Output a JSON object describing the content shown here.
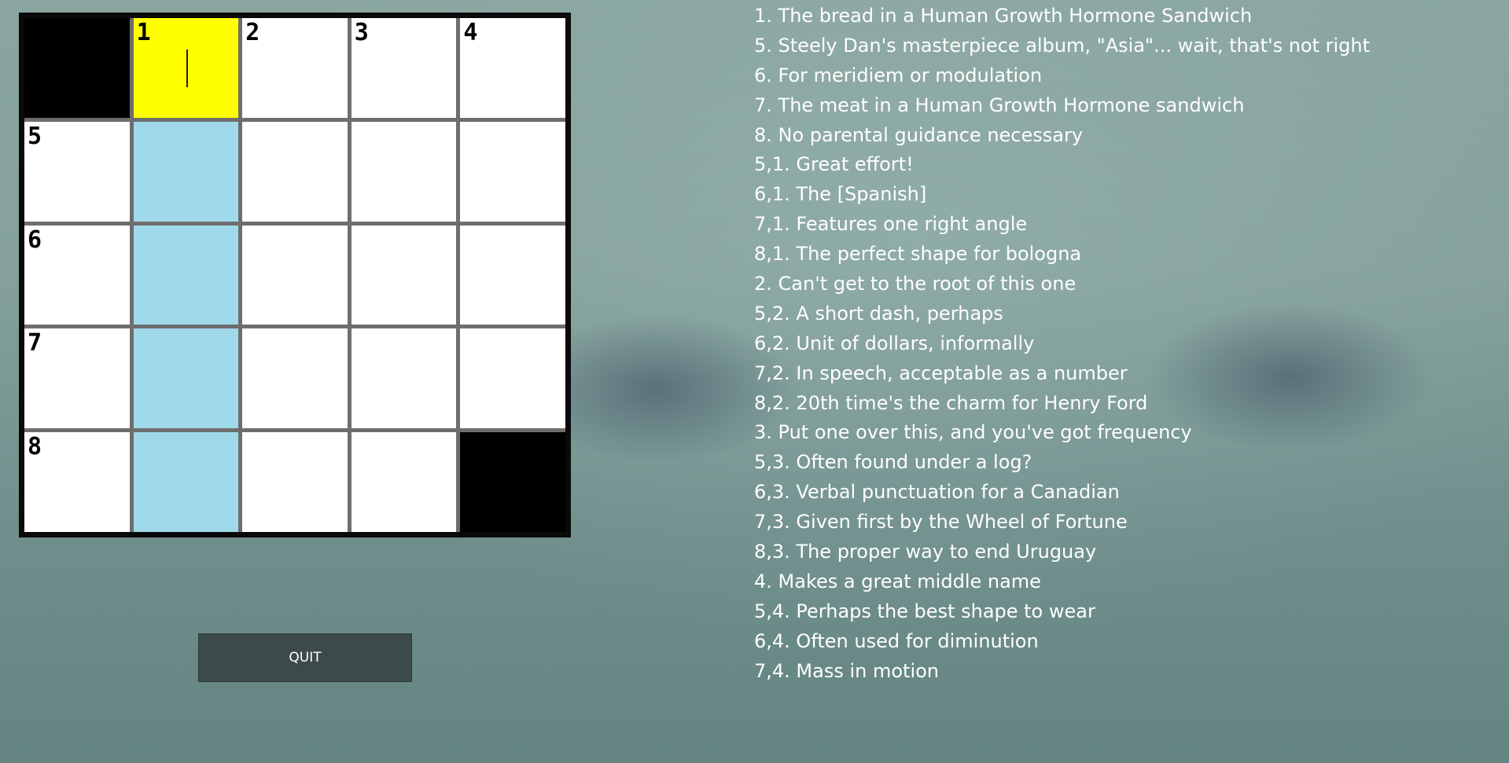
{
  "grid": {
    "rows": [
      [
        {
          "type": "block",
          "number": ""
        },
        {
          "type": "active",
          "number": "1"
        },
        {
          "type": "open",
          "number": "2"
        },
        {
          "type": "open",
          "number": "3"
        },
        {
          "type": "open",
          "number": "4"
        }
      ],
      [
        {
          "type": "open",
          "number": "5"
        },
        {
          "type": "highlight",
          "number": ""
        },
        {
          "type": "open",
          "number": ""
        },
        {
          "type": "open",
          "number": ""
        },
        {
          "type": "open",
          "number": ""
        }
      ],
      [
        {
          "type": "open",
          "number": "6"
        },
        {
          "type": "highlight",
          "number": ""
        },
        {
          "type": "open",
          "number": ""
        },
        {
          "type": "open",
          "number": ""
        },
        {
          "type": "open",
          "number": ""
        }
      ],
      [
        {
          "type": "open",
          "number": "7"
        },
        {
          "type": "highlight",
          "number": ""
        },
        {
          "type": "open",
          "number": ""
        },
        {
          "type": "open",
          "number": ""
        },
        {
          "type": "open",
          "number": ""
        }
      ],
      [
        {
          "type": "open",
          "number": "8"
        },
        {
          "type": "highlight",
          "number": ""
        },
        {
          "type": "open",
          "number": ""
        },
        {
          "type": "open",
          "number": ""
        },
        {
          "type": "block",
          "number": ""
        }
      ]
    ],
    "colors": {
      "active": "#ffff00",
      "highlight": "#9fd9ea",
      "block": "#000000",
      "open": "#ffffff"
    }
  },
  "quit_label": "QUIT",
  "clues": [
    "1. The bread in a Human Growth Hormone Sandwich",
    "5. Steely Dan's masterpiece album, \"Asia\"... wait, that's not right",
    "6. For meridiem or modulation",
    "7. The meat in a Human Growth Hormone sandwich",
    "8. No parental guidance necessary",
    "5,1. Great effort!",
    "6,1. The [Spanish]",
    "7,1. Features one right angle",
    "8,1. The perfect shape for bologna",
    "2. Can't get to the root of this one",
    "5,2. A short dash, perhaps",
    "6,2. Unit of dollars, informally",
    "7,2. In speech, acceptable as a number",
    "8,2. 20th time's the charm for Henry Ford",
    "3. Put one over this, and you've got frequency",
    "5,3. Often found under a log?",
    "6,3. Verbal punctuation for a Canadian",
    "7,3. Given first by the Wheel of Fortune",
    "8,3. The proper way to end Uruguay",
    "4. Makes a great middle name",
    "5,4. Perhaps the best shape to wear",
    "6,4. Often used for diminution",
    "7,4. Mass in motion"
  ]
}
